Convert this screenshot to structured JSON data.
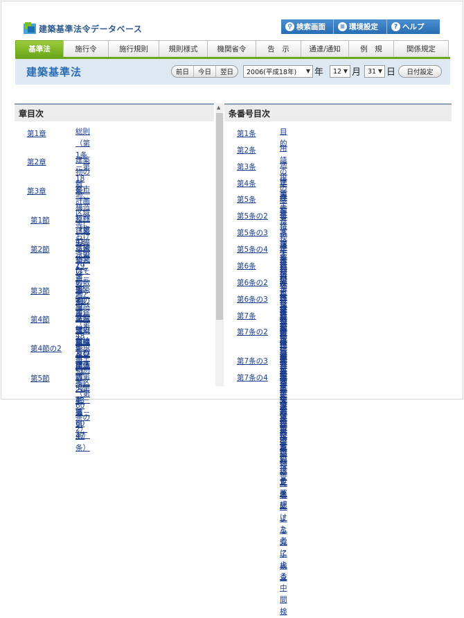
{
  "app": {
    "title": "建築基準法令データベース"
  },
  "top_buttons": [
    {
      "label": "検索画面",
      "icon": "search-icon"
    },
    {
      "label": "環境設定",
      "icon": "settings-icon"
    },
    {
      "label": "ヘルプ",
      "icon": "help-icon"
    }
  ],
  "tabs": [
    {
      "label": "基準法",
      "active": true
    },
    {
      "label": "施行令"
    },
    {
      "label": "施行規則"
    },
    {
      "label": "規則様式"
    },
    {
      "label": "機関省令"
    },
    {
      "label": "告　示"
    },
    {
      "label": "通達/通知"
    },
    {
      "label": "例　規"
    },
    {
      "label": "関係規定"
    }
  ],
  "law_title": "建築基準法",
  "date_nav": {
    "prev": "前日",
    "today": "今日",
    "next": "翌日",
    "year_value": "2006(平成18年)",
    "year_unit": "年",
    "month_value": "12",
    "month_unit": "月",
    "day_value": "31",
    "day_unit": "日",
    "set_button": "日付設定"
  },
  "chapters": {
    "header": "章目次",
    "items": [
      {
        "num": "第1章",
        "lines": [
          "総則",
          "（第1条－第18条）"
        ]
      },
      {
        "num": "第2章",
        "lines": [
          "建築物の敷地、構造及び建築設備",
          "（第19条－第41条）"
        ]
      },
      {
        "num": "第3章",
        "lines": [
          "都市計画区域等における建築物の",
          "敷地、構造、建築設備及び用途"
        ]
      },
      {
        "num": "第1節",
        "lines": [
          "総則",
          "（第41条の2・第42条）"
        ]
      },
      {
        "num": "第2節",
        "lines": [
          "建築物又はその敷地と道路又は壁",
          "面線との関係等",
          "（第43条－第47条）"
        ]
      },
      {
        "num": "第3節",
        "lines": [
          "建築物の用途",
          "（第48条－第51条）"
        ]
      },
      {
        "num": "第4節",
        "lines": [
          "建築物の敷地及び構造",
          "（第52条－第60条）"
        ]
      },
      {
        "num": "第4節の2",
        "lines": [
          "都市再生特別地区",
          "（第60条の2）"
        ]
      },
      {
        "num": "第5節",
        "lines": [
          "防火地域"
        ]
      }
    ]
  },
  "articles": {
    "header": "条番号目次",
    "items": [
      {
        "num": "第1条",
        "lines": [
          "目的"
        ]
      },
      {
        "num": "第2条",
        "lines": [
          "用語の定義"
        ]
      },
      {
        "num": "第3条",
        "lines": [
          "適用の除外"
        ]
      },
      {
        "num": "第4条",
        "lines": [
          "建築主事"
        ]
      },
      {
        "num": "第5条",
        "lines": [
          "建築基準適合判定資格者検定"
        ]
      },
      {
        "num": "第5条の2",
        "lines": [
          "資格検定事務を行う者の指定"
        ]
      },
      {
        "num": "第5条の3",
        "lines": [
          "受検手数料"
        ]
      },
      {
        "num": "第5条の4",
        "lines": [
          "建築物の設計及び工事監理"
        ]
      },
      {
        "num": "第6条",
        "lines": [
          "建築物の建築等に関する申請及び確認"
        ]
      },
      {
        "num": "第6条の2",
        "lines": [
          "国土交通大臣等の指定を受けた者による確認"
        ]
      },
      {
        "num": "第6条の3",
        "lines": [
          "建築物の建築に関する確認の特例"
        ]
      },
      {
        "num": "第7条",
        "lines": [
          "建築物に関する完了検査"
        ]
      },
      {
        "num": "第7条の2",
        "lines": [
          "国土交通大臣等の指定を受けた者による完了検",
          "査"
        ]
      },
      {
        "num": "第7条の3",
        "lines": [
          "建築物に関する中間検査"
        ]
      },
      {
        "num": "第7条の4",
        "lines": [
          "国土交通大臣等の指定を受けた者による中間検"
        ]
      }
    ]
  }
}
